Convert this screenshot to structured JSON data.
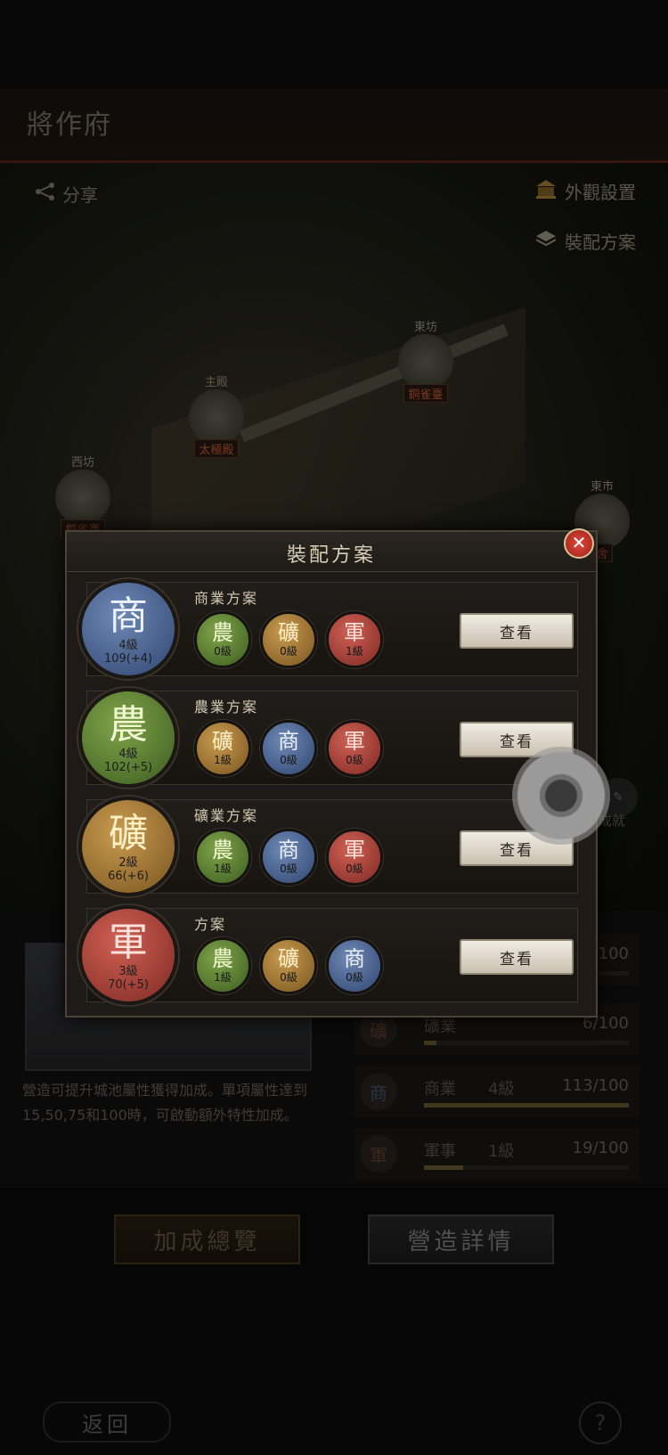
{
  "header": {
    "title": "將作府"
  },
  "toolbar": {
    "share": "分享",
    "appearance": "外觀設置",
    "loadout": "裝配方案"
  },
  "map": {
    "markers": [
      {
        "name": "東坊",
        "tag": "銅雀臺"
      },
      {
        "name": "主殿",
        "tag": "太極殿"
      },
      {
        "name": "西坊",
        "tag": "銅雀臺"
      },
      {
        "name": "東市",
        "tag": "舍"
      }
    ]
  },
  "info": {
    "description": "營造可提升城池屬性獲得加成。單項屬性達到15,50,75和100時，可啟動額外特性加成。"
  },
  "stats": [
    {
      "icon": "軍",
      "label": "",
      "level": "",
      "value": "/100",
      "progress": 0.4
    },
    {
      "icon": "礦",
      "label": "礦業",
      "level": "",
      "value": "6/100",
      "progress": 0.06
    },
    {
      "icon": "商",
      "label": "商業",
      "level": "4級",
      "value": "113/100",
      "progress": 1.0
    },
    {
      "icon": "軍",
      "label": "軍事",
      "level": "1級",
      "value": "19/100",
      "progress": 0.19
    }
  ],
  "buttons": {
    "bonus_overview": "加成總覽",
    "build_details": "營造詳情",
    "back": "返回",
    "help": "?"
  },
  "side": {
    "achievement": "成就"
  },
  "modal": {
    "title": "裝配方案",
    "close": "✕",
    "view_label": "查看",
    "plans": [
      {
        "name": "商業方案",
        "main": {
          "char": "商",
          "level": "4級",
          "points": "109(+4)"
        },
        "subs": [
          {
            "char": "農",
            "level": "0級"
          },
          {
            "char": "礦",
            "level": "0級"
          },
          {
            "char": "軍",
            "level": "1級"
          }
        ]
      },
      {
        "name": "農業方案",
        "main": {
          "char": "農",
          "level": "4級",
          "points": "102(+5)"
        },
        "subs": [
          {
            "char": "礦",
            "level": "1級"
          },
          {
            "char": "商",
            "level": "0級"
          },
          {
            "char": "軍",
            "level": "0級"
          }
        ]
      },
      {
        "name": "礦業方案",
        "main": {
          "char": "礦",
          "level": "2級",
          "points": "66(+6)"
        },
        "subs": [
          {
            "char": "農",
            "level": "1級"
          },
          {
            "char": "商",
            "level": "0級"
          },
          {
            "char": "軍",
            "level": "0級"
          }
        ]
      },
      {
        "name": "方案",
        "main": {
          "char": "軍",
          "level": "3級",
          "points": "70(+5)"
        },
        "subs": [
          {
            "char": "農",
            "level": "1級"
          },
          {
            "char": "礦",
            "level": "0級"
          },
          {
            "char": "商",
            "level": "0級"
          }
        ]
      }
    ]
  },
  "colors": {
    "commerce": "#4f6a97",
    "agriculture": "#5d8534",
    "mining": "#b08538",
    "military": "#b8463b",
    "accent_red": "#c0392b"
  }
}
